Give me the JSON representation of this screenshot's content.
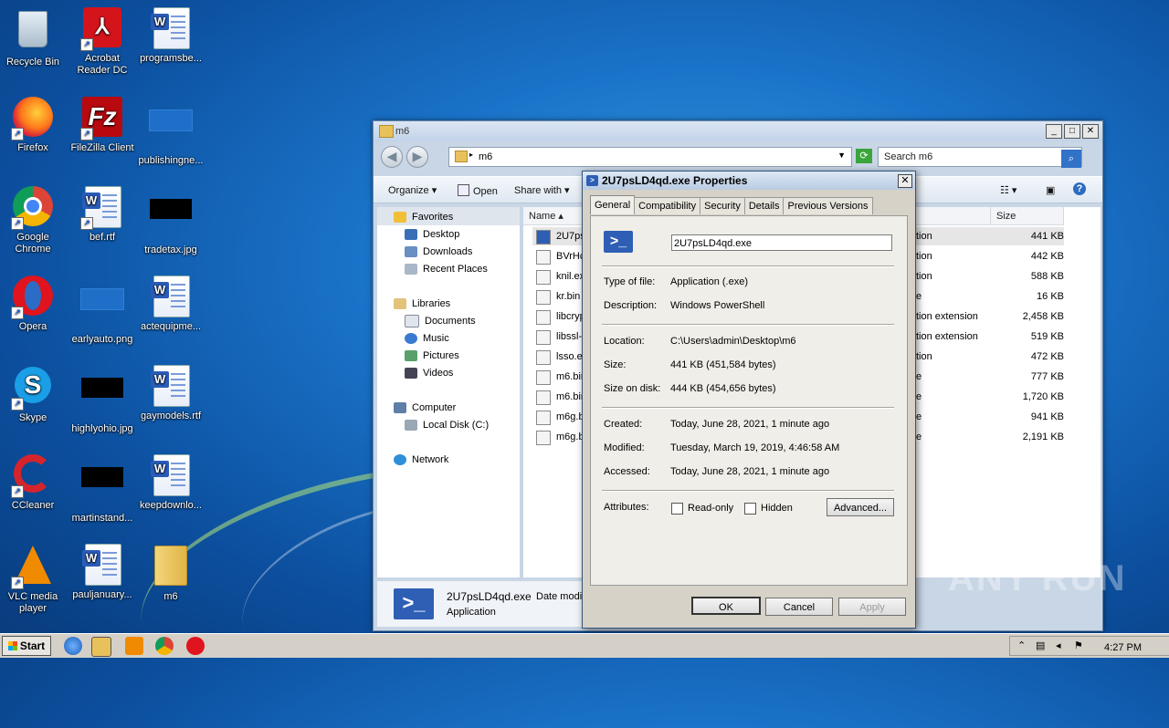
{
  "desktop": {
    "icons": [
      {
        "label": "Recycle Bin"
      },
      {
        "label": "Acrobat Reader DC"
      },
      {
        "label": "programsbe..."
      },
      {
        "label": "Firefox"
      },
      {
        "label": "FileZilla Client"
      },
      {
        "label": "publishingne..."
      },
      {
        "label": "Google Chrome"
      },
      {
        "label": "bef.rtf"
      },
      {
        "label": "tradetax.jpg"
      },
      {
        "label": "Opera"
      },
      {
        "label": "earlyauto.png"
      },
      {
        "label": "actequipme..."
      },
      {
        "label": "Skype"
      },
      {
        "label": "highlyohio.jpg"
      },
      {
        "label": "gaymodels.rtf"
      },
      {
        "label": "CCleaner"
      },
      {
        "label": "martinstand..."
      },
      {
        "label": "keepdownlo..."
      },
      {
        "label": "VLC media player"
      },
      {
        "label": "pauljanuary..."
      },
      {
        "label": "m6"
      }
    ],
    "watermark": "ANY RUN"
  },
  "explorer": {
    "title": "m6",
    "address": "m6",
    "search_placeholder": "Search m6",
    "toolbar": {
      "organize": "Organize",
      "open": "Open",
      "share_with": "Share with"
    },
    "nav": {
      "favorites": "Favorites",
      "desktop": "Desktop",
      "downloads": "Downloads",
      "recent_places": "Recent Places",
      "libraries": "Libraries",
      "documents": "Documents",
      "music": "Music",
      "pictures": "Pictures",
      "videos": "Videos",
      "computer": "Computer",
      "local_disk": "Local Disk (C:)",
      "network": "Network"
    },
    "columns": {
      "name": "Name",
      "size": "Size"
    },
    "files": [
      {
        "name": "2U7ps",
        "type": "tion",
        "size": "441 KB"
      },
      {
        "name": "BVrHc",
        "type": "tion",
        "size": "442 KB"
      },
      {
        "name": "knil.ex",
        "type": "tion",
        "size": "588 KB"
      },
      {
        "name": "kr.bin",
        "type": "e",
        "size": "16 KB"
      },
      {
        "name": "libcryp",
        "type": "tion extension",
        "size": "2,458 KB"
      },
      {
        "name": "libssl-",
        "type": "tion extension",
        "size": "519 KB"
      },
      {
        "name": "lsso.e",
        "type": "tion",
        "size": "472 KB"
      },
      {
        "name": "m6.bin",
        "type": "e",
        "size": "777 KB"
      },
      {
        "name": "m6.bin",
        "type": "e",
        "size": "1,720 KB"
      },
      {
        "name": "m6g.b",
        "type": "e",
        "size": "941 KB"
      },
      {
        "name": "m6g.b",
        "type": "e",
        "size": "2,191 KB"
      }
    ],
    "details": {
      "filename": "2U7psLD4qd.exe",
      "date_label": "Date modi",
      "type": "Application"
    }
  },
  "dialog": {
    "title": "2U7psLD4qd.exe Properties",
    "tabs": [
      "General",
      "Compatibility",
      "Security",
      "Details",
      "Previous Versions"
    ],
    "filename": "2U7psLD4qd.exe",
    "type_label": "Type of file:",
    "type_value": "Application (.exe)",
    "desc_label": "Description:",
    "desc_value": "Windows PowerShell",
    "location_label": "Location:",
    "location_value": "C:\\Users\\admin\\Desktop\\m6",
    "size_label": "Size:",
    "size_value": "441 KB (451,584 bytes)",
    "disk_label": "Size on disk:",
    "disk_value": "444 KB (454,656 bytes)",
    "created_label": "Created:",
    "created_value": "Today, June 28, 2021, 1 minute ago",
    "modified_label": "Modified:",
    "modified_value": "Tuesday, March 19, 2019, 4:46:58 AM",
    "accessed_label": "Accessed:",
    "accessed_value": "Today, June 28, 2021, 1 minute ago",
    "attributes_label": "Attributes:",
    "readonly_label": "Read-only",
    "hidden_label": "Hidden",
    "advanced_label": "Advanced...",
    "ok_label": "OK",
    "cancel_label": "Cancel",
    "apply_label": "Apply"
  },
  "taskbar": {
    "start_label": "Start",
    "clock": "4:27 PM"
  }
}
